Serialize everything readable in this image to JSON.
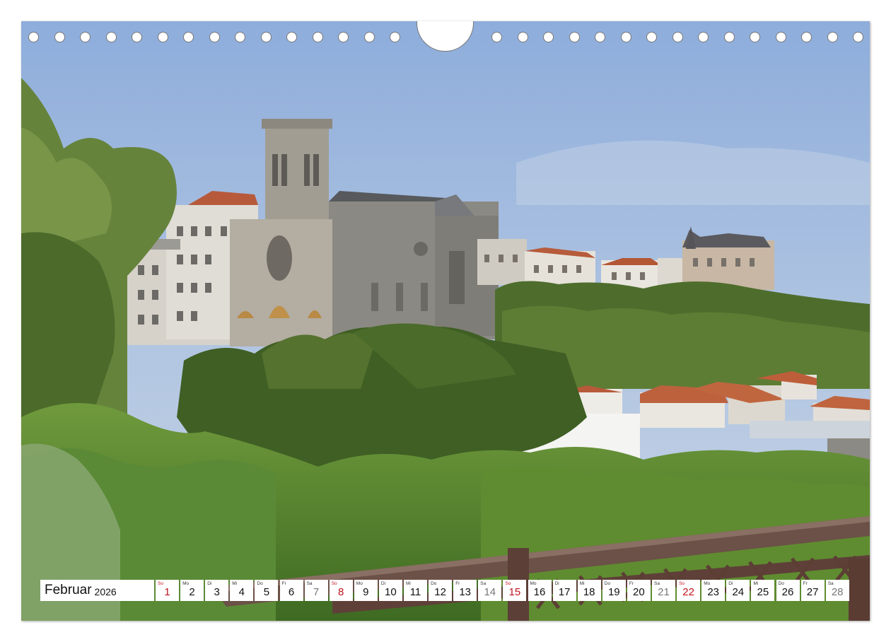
{
  "calendar": {
    "month": "Februar",
    "year": "2026",
    "days": [
      {
        "wd": "So",
        "n": "1",
        "type": "sun"
      },
      {
        "wd": "Mo",
        "n": "2",
        "type": "wk"
      },
      {
        "wd": "Di",
        "n": "3",
        "type": "wk"
      },
      {
        "wd": "Mi",
        "n": "4",
        "type": "wk"
      },
      {
        "wd": "Do",
        "n": "5",
        "type": "wk"
      },
      {
        "wd": "Fr",
        "n": "6",
        "type": "wk"
      },
      {
        "wd": "Sa",
        "n": "7",
        "type": "sat"
      },
      {
        "wd": "So",
        "n": "8",
        "type": "sun"
      },
      {
        "wd": "Mo",
        "n": "9",
        "type": "wk"
      },
      {
        "wd": "Di",
        "n": "10",
        "type": "wk"
      },
      {
        "wd": "Mi",
        "n": "11",
        "type": "wk"
      },
      {
        "wd": "Do",
        "n": "12",
        "type": "wk"
      },
      {
        "wd": "Fr",
        "n": "13",
        "type": "wk"
      },
      {
        "wd": "Sa",
        "n": "14",
        "type": "sat"
      },
      {
        "wd": "So",
        "n": "15",
        "type": "sun"
      },
      {
        "wd": "Mo",
        "n": "16",
        "type": "wk"
      },
      {
        "wd": "Di",
        "n": "17",
        "type": "wk"
      },
      {
        "wd": "Mi",
        "n": "18",
        "type": "wk"
      },
      {
        "wd": "Do",
        "n": "19",
        "type": "wk"
      },
      {
        "wd": "Fr",
        "n": "20",
        "type": "wk"
      },
      {
        "wd": "Sa",
        "n": "21",
        "type": "sat"
      },
      {
        "wd": "So",
        "n": "22",
        "type": "sun"
      },
      {
        "wd": "Mo",
        "n": "23",
        "type": "wk"
      },
      {
        "wd": "Di",
        "n": "24",
        "type": "wk"
      },
      {
        "wd": "Mi",
        "n": "25",
        "type": "wk"
      },
      {
        "wd": "Do",
        "n": "26",
        "type": "wk"
      },
      {
        "wd": "Fr",
        "n": "27",
        "type": "wk"
      },
      {
        "wd": "Sa",
        "n": "28",
        "type": "sat"
      }
    ]
  },
  "colors": {
    "sunday": "#c0141e",
    "saturday": "#777777",
    "sky": "#9cb6d9"
  }
}
